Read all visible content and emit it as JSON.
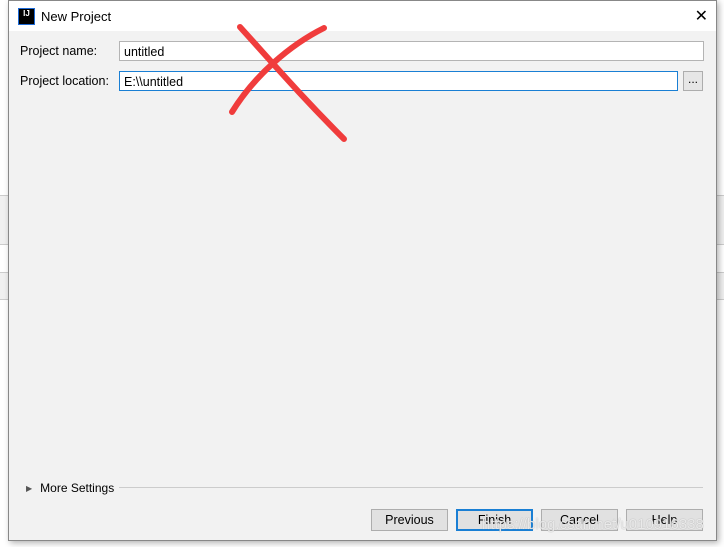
{
  "dialog": {
    "title": "New Project",
    "close_icon": "close-icon"
  },
  "form": {
    "name_label": "Project name:",
    "name_value": "untitled",
    "location_label": "Project location:",
    "location_value": "E:\\\\untitled",
    "browse_label": "..."
  },
  "more_settings": "More Settings",
  "buttons": {
    "previous": "Previous",
    "finish": "Finish",
    "cancel": "Cancel",
    "help": "Help"
  },
  "watermark": "https://blog.csdn.net/u010916338",
  "colors": {
    "accent": "#1a7fd4",
    "cross": "#f03c3c"
  }
}
